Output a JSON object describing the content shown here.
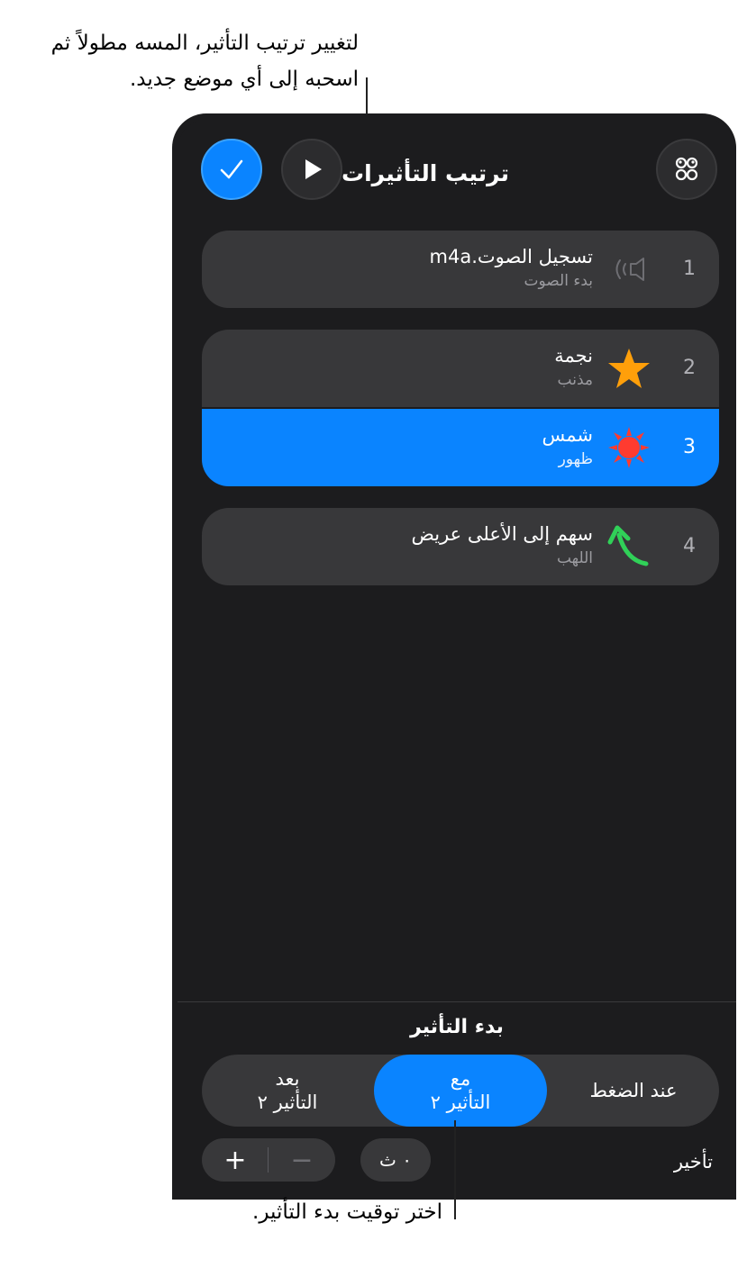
{
  "callouts": {
    "reorder_line1": "لتغيير ترتيب التأثير، المسه مطولاً ثم",
    "reorder_line2": "اسحبه إلى أي موضع جديد.",
    "timing": "اختر توقيت بدء التأثير."
  },
  "header": {
    "title": "ترتيب التأثيرات",
    "done_icon": "checkmark-icon",
    "play_icon": "play-icon",
    "menu_icon": "effects-grid-icon"
  },
  "effects": [
    {
      "number": "1",
      "title": "تسجيل الصوت.m4a",
      "subtitle": "بدء الصوت",
      "icon": "speaker-icon"
    },
    {
      "number": "2",
      "title": "نجمة",
      "subtitle": "مذنب",
      "icon": "star-icon",
      "icon_color": "#ff9f0a"
    },
    {
      "number": "3",
      "title": "شمس",
      "subtitle": "ظهور",
      "icon": "sun-icon",
      "icon_color": "#ff3b30",
      "selected": true
    },
    {
      "number": "4",
      "title": "سهم إلى الأعلى عريض",
      "subtitle": "اللهب",
      "icon": "arrow-up-curved-icon",
      "icon_color": "#30d158"
    }
  ],
  "start": {
    "title": "بدء التأثير",
    "options": [
      {
        "line1": "عند الضغط",
        "line2": ""
      },
      {
        "line1": "مع",
        "line2": "التأثير ٢",
        "selected": true
      },
      {
        "line1": "بعد",
        "line2": "التأثير ٢"
      }
    ]
  },
  "delay": {
    "label": "تأخير",
    "value": "٠ ث",
    "plus": "+",
    "minus": "−"
  },
  "colors": {
    "accent": "#0a84ff",
    "panel": "#1c1c1e",
    "row": "#38383a"
  }
}
